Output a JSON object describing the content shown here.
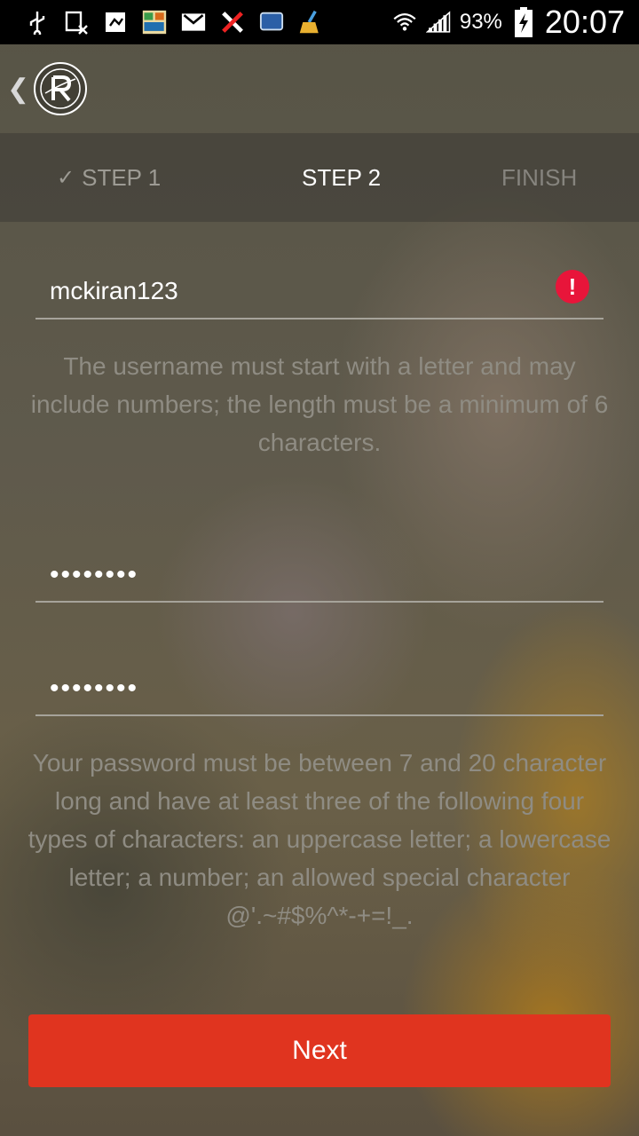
{
  "status_bar": {
    "battery": "93%",
    "time": "20:07",
    "icons": [
      "usb-icon",
      "sim-icon",
      "file-icon",
      "app-icon",
      "gmail-icon",
      "tools-icon",
      "screen-icon",
      "cleaner-icon",
      "wifi-icon",
      "signal-icon",
      "battery-icon"
    ]
  },
  "app_bar": {
    "back": "❮",
    "logo_letter": "R"
  },
  "steps": {
    "step1": "STEP 1",
    "step1_check": "✓",
    "step2": "STEP 2",
    "finish": "FINISH"
  },
  "form": {
    "username_value": "mckiran123",
    "username_hint": "The username must start with a letter and may include numbers; the length must be a minimum of 6 characters.",
    "password_value": "••••••••",
    "confirm_value": "••••••••",
    "password_hint": "Your password must be between 7 and 20 character long and have at least three of the following four types of characters: an uppercase letter; a lowercase letter; a number; an allowed special character @'.~#$%^*-+=!_.",
    "error_icon": "!"
  },
  "next_button": "Next",
  "colors": {
    "accent": "#e0341f",
    "error": "#e8153a",
    "hint_text": "#8f8c83"
  }
}
